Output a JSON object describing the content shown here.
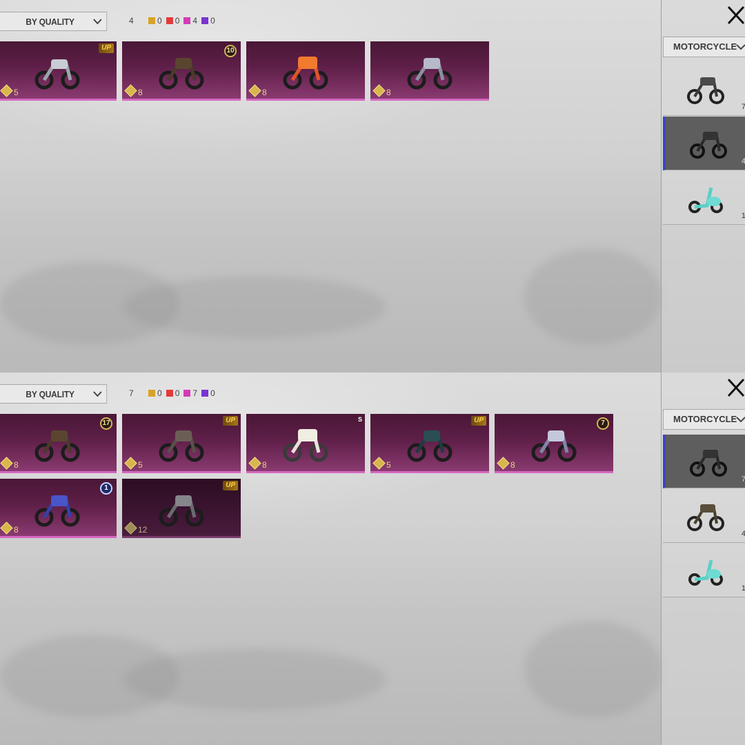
{
  "panels": [
    {
      "sort_label": "BY QUALITY",
      "total": "4",
      "stats": [
        {
          "color": "#d9a227",
          "count": "0"
        },
        {
          "color": "#e23b3b",
          "count": "0"
        },
        {
          "color": "#d43bb6",
          "count": "4"
        },
        {
          "color": "#7a33d1",
          "count": "0"
        }
      ],
      "cards": [
        {
          "count": "5",
          "badge": "UP"
        },
        {
          "count": "8",
          "badge": "10"
        },
        {
          "count": "8",
          "badge": ""
        },
        {
          "count": "8",
          "badge": ""
        }
      ],
      "category_label": "MOTORCYCLE",
      "side_items": [
        {
          "count": "7",
          "selected": false
        },
        {
          "count": "4",
          "selected": true
        },
        {
          "count": "1",
          "selected": false
        }
      ]
    },
    {
      "sort_label": "BY QUALITY",
      "total": "7",
      "stats": [
        {
          "color": "#d9a227",
          "count": "0"
        },
        {
          "color": "#e23b3b",
          "count": "0"
        },
        {
          "color": "#d43bb6",
          "count": "7"
        },
        {
          "color": "#7a33d1",
          "count": "0"
        }
      ],
      "cards": [
        {
          "count": "8",
          "badge": "17"
        },
        {
          "count": "5",
          "badge": "UP"
        },
        {
          "count": "8",
          "badge": "S"
        },
        {
          "count": "5",
          "badge": "UP"
        },
        {
          "count": "8",
          "badge": "7"
        },
        {
          "count": "8",
          "badge": "1"
        },
        {
          "count": "12",
          "badge": "UP"
        }
      ],
      "category_label": "MOTORCYCLE",
      "side_items": [
        {
          "count": "7",
          "selected": true
        },
        {
          "count": "4",
          "selected": false
        },
        {
          "count": "1",
          "selected": false
        }
      ]
    }
  ]
}
